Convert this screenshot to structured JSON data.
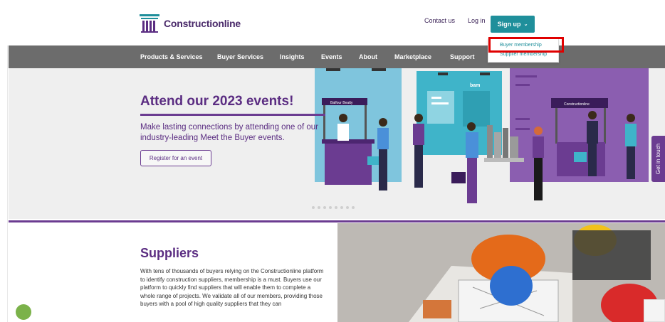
{
  "header": {
    "brand": "Constructionline",
    "links": [
      "Contact us",
      "Log in"
    ],
    "signup_label": "Sign up",
    "dropdown": [
      "Buyer membership",
      "Supplier membership"
    ]
  },
  "nav": [
    "Products & Services",
    "Buyer Services",
    "Insights",
    "Events",
    "About",
    "Marketplace",
    "Support"
  ],
  "hero": {
    "title": "Attend our 2023 events!",
    "text": "Make lasting connections by attending one of our industry-leading Meet the Buyer events.",
    "button": "Register for an event",
    "booth_signs": [
      "Balfour Beatty",
      "bam",
      "Constructionline"
    ]
  },
  "side_tab": "Get in touch",
  "suppliers": {
    "title": "Suppliers",
    "text": "With tens of thousands of buyers relying on the Constructionline platform to identify construction suppliers, membership is a must. Buyers use our platform to quickly find suppliers that will enable them to complete a whole range of projects. We validate all of our members, providing those buyers with a pool of high quality suppliers that they can"
  },
  "colors": {
    "brand_purple": "#5b2d82",
    "accent_teal": "#1f8f9b",
    "nav_gray": "#6c6c6c",
    "highlight_red": "#e00000"
  }
}
